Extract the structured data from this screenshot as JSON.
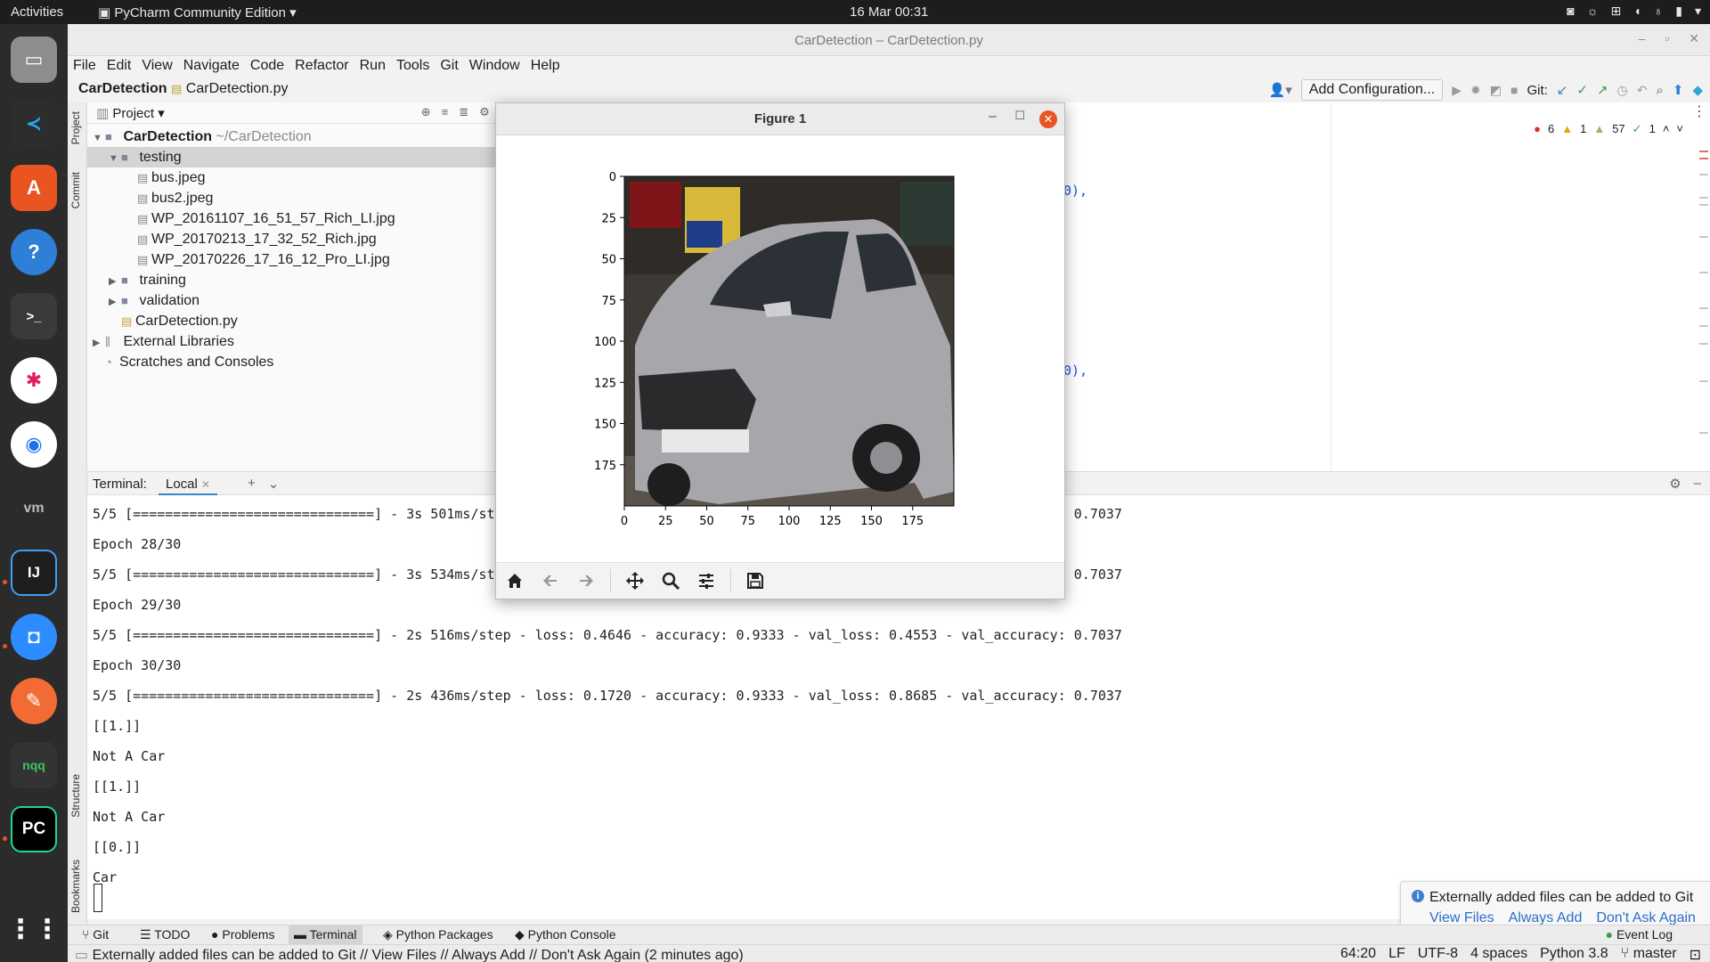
{
  "topbar": {
    "activities": "Activities",
    "app_menu": "PyCharm Community Edition",
    "clock": "16 Mar  00:31"
  },
  "window": {
    "title": "CarDetection – CarDetection.py"
  },
  "menu": [
    "File",
    "Edit",
    "View",
    "Navigate",
    "Code",
    "Refactor",
    "Run",
    "Tools",
    "Git",
    "Window",
    "Help"
  ],
  "breadcrumb": {
    "project": "CarDetection",
    "file": "CarDetection.py"
  },
  "toolbar": {
    "add_config": "Add Configuration...",
    "git_label": "Git:"
  },
  "side_tabs": {
    "project": "Project",
    "commit": "Commit",
    "structure": "Structure",
    "bookmarks": "Bookmarks"
  },
  "project_panel": {
    "header": "Project",
    "root_name": "CarDetection",
    "root_path": "~/CarDetection",
    "items": [
      {
        "label": "testing",
        "kind": "folder",
        "open": true
      },
      {
        "label": "bus.jpeg",
        "kind": "file"
      },
      {
        "label": "bus2.jpeg",
        "kind": "file"
      },
      {
        "label": "WP_20161107_16_51_57_Rich_LI.jpg",
        "kind": "file"
      },
      {
        "label": "WP_20170213_17_32_52_Rich.jpg",
        "kind": "file"
      },
      {
        "label": "WP_20170226_17_16_12_Pro_LI.jpg",
        "kind": "file"
      },
      {
        "label": "training",
        "kind": "folder"
      },
      {
        "label": "validation",
        "kind": "folder"
      },
      {
        "label": "CarDetection.py",
        "kind": "pyfile"
      },
      {
        "label": "External Libraries",
        "kind": "lib"
      },
      {
        "label": "Scratches and Consoles",
        "kind": "scratch"
      }
    ]
  },
  "editor": {
    "visible_fragments": [
      "0),",
      "0),"
    ],
    "inspections": {
      "errors": "6",
      "warnings": "1",
      "weak": "57",
      "ok": "1"
    }
  },
  "terminal": {
    "label": "Terminal:",
    "tab": "Local",
    "lines": [
      "5/5 [==============================] - 3s 501ms/step - loss: 0.4646 - accuracy: 0.9333 - val_loss: 0.4553 - val_accuracy: 0.7037",
      "Epoch 28/30",
      "5/5 [==============================] - 3s 534ms/step - loss: 0.4646 - accuracy: 0.9333 - val_loss: 0.4553 - val_accuracy: 0.7037",
      "Epoch 29/30",
      "5/5 [==============================] - 2s 516ms/step - loss: 0.4646 - accuracy: 0.9333 - val_loss: 0.4553 - val_accuracy: 0.7037",
      "Epoch 30/30",
      "5/5 [==============================] - 2s 436ms/step - loss: 0.1720 - accuracy: 0.9333 - val_loss: 0.8685 - val_accuracy: 0.7037",
      "[[1.]]",
      "Not A Car",
      "[[1.]]",
      "Not A Car",
      "[[0.]]",
      "Car"
    ]
  },
  "notification": {
    "message": "Externally added files can be added to Git",
    "actions": [
      "View Files",
      "Always Add",
      "Don't Ask Again"
    ]
  },
  "tool_tabs": [
    "Git",
    "TODO",
    "Problems",
    "Terminal",
    "Python Packages",
    "Python Console"
  ],
  "event_log": "Event Log",
  "status": {
    "message": "Externally added files can be added to Git // View Files // Always Add // Don't Ask Again (2 minutes ago)",
    "position": "64:20",
    "line_sep": "LF",
    "encoding": "UTF-8",
    "indent": "4 spaces",
    "interpreter": "Python 3.8",
    "branch": "master"
  },
  "figure": {
    "title": "Figure 1",
    "x_ticks": [
      "0",
      "25",
      "50",
      "75",
      "100",
      "125",
      "150",
      "175"
    ],
    "y_ticks": [
      "0",
      "25",
      "50",
      "75",
      "100",
      "125",
      "150",
      "175"
    ],
    "image_subject": "silver hatchback car",
    "toolbar_icons": [
      "home-icon",
      "back-icon",
      "forward-icon",
      "pan-icon",
      "zoom-icon",
      "configure-icon",
      "save-icon"
    ]
  }
}
